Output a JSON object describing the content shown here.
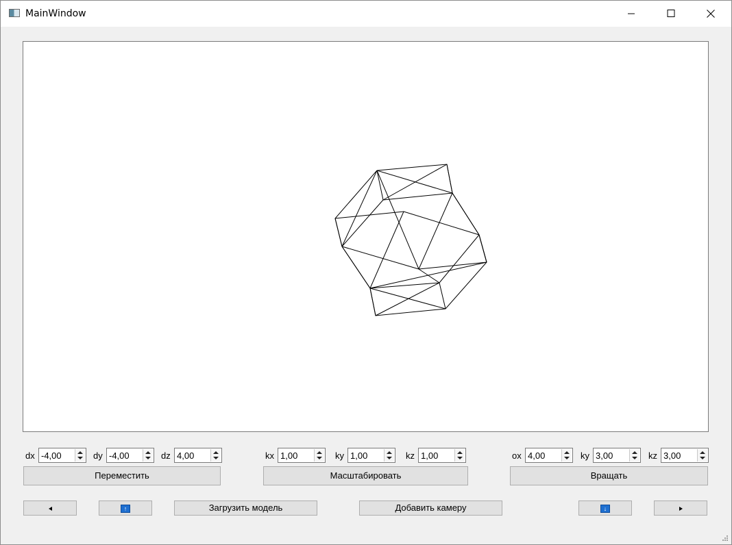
{
  "window": {
    "title": "MainWindow",
    "controls": [
      "minimize-icon",
      "maximize-icon",
      "close-icon"
    ]
  },
  "viewport": {
    "content": "wireframe polyhedron",
    "background": "#ffffff",
    "line_color": "#000000"
  },
  "translate": {
    "dx_label": "dx",
    "dx_value": "-4,00",
    "dy_label": "dy",
    "dy_value": "-4,00",
    "dz_label": "dz",
    "dz_value": "4,00",
    "button_label": "Переместить"
  },
  "scale": {
    "kx_label": "kx",
    "kx_value": "1,00",
    "ky_label": "ky",
    "ky_value": "1,00",
    "kz_label": "kz",
    "kz_value": "1,00",
    "button_label": "Масштабировать"
  },
  "rotate": {
    "ox_label": "ox",
    "ox_value": "4,00",
    "ky_label": "ky",
    "ky_value": "3,00",
    "kz_label": "kz",
    "kz_value": "3,00",
    "button_label": "Вращать"
  },
  "bottom_bar": {
    "prev_icon": "triangle-left-icon",
    "up_icon": "arrow-up-icon",
    "load_model_label": "Загрузить модель",
    "add_camera_label": "Добавить камеру",
    "down_icon": "arrow-down-icon",
    "next_icon": "triangle-right-icon"
  }
}
